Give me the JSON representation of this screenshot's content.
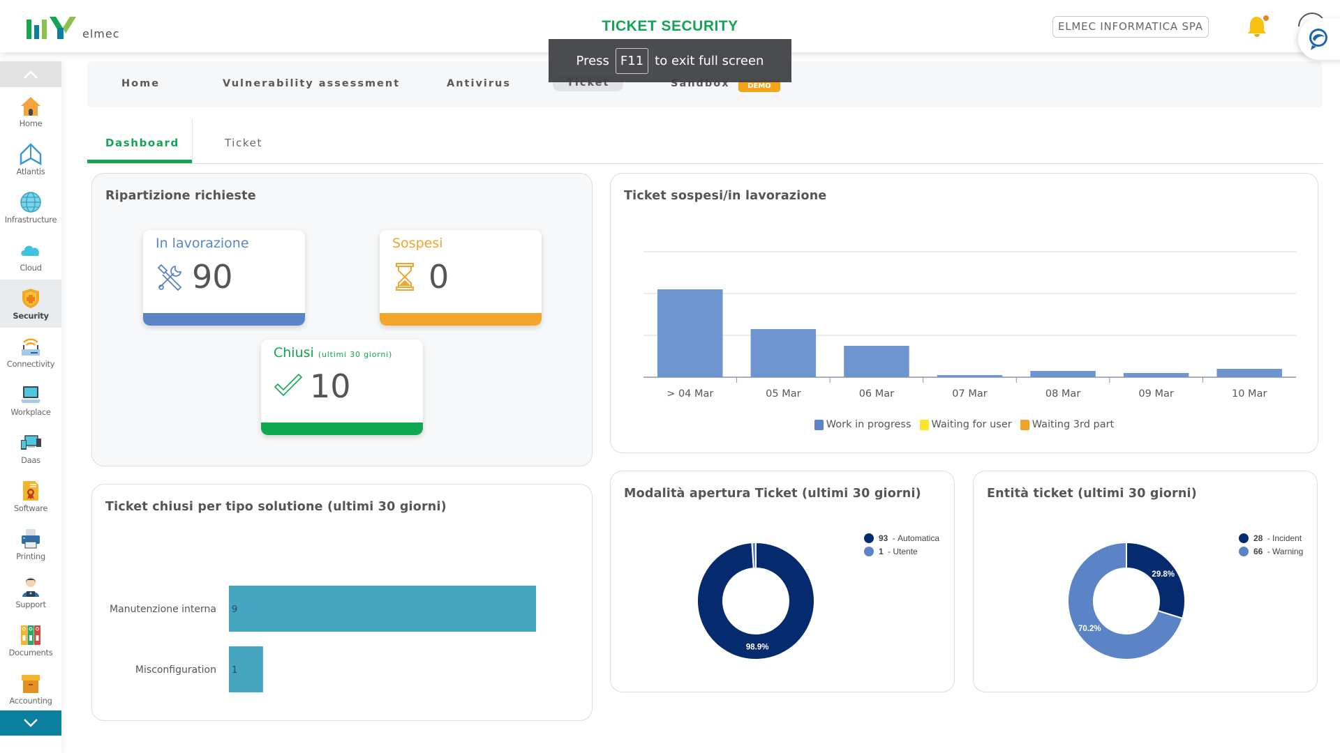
{
  "header": {
    "logo_text": "elmec",
    "title": "TICKET SECURITY",
    "company": "ELMEC INFORMATICA SPA",
    "notification_icon": "bell-icon",
    "chat_icon": "chat-support-icon"
  },
  "fullscreen_notice": {
    "prefix": "Press",
    "key": "F11",
    "suffix": "to exit full screen"
  },
  "sidebar": {
    "items": [
      {
        "label": "Home",
        "icon": "home-icon"
      },
      {
        "label": "Atlantis",
        "icon": "atlantis-icon"
      },
      {
        "label": "Infrastructure",
        "icon": "globe-icon"
      },
      {
        "label": "Cloud",
        "icon": "cloud-icon"
      },
      {
        "label": "Security",
        "icon": "shield-icon",
        "active": true
      },
      {
        "label": "Connectivity",
        "icon": "router-icon"
      },
      {
        "label": "Workplace",
        "icon": "laptop-icon"
      },
      {
        "label": "Daas",
        "icon": "devices-icon"
      },
      {
        "label": "Software",
        "icon": "certificate-icon"
      },
      {
        "label": "Printing",
        "icon": "printer-icon"
      },
      {
        "label": "Support",
        "icon": "operator-icon"
      },
      {
        "label": "Documents",
        "icon": "binders-icon"
      },
      {
        "label": "Accounting",
        "icon": "box-icon"
      }
    ]
  },
  "topnav": {
    "items": [
      {
        "label": "Home"
      },
      {
        "label": "Vulnerability assessment"
      },
      {
        "label": "Antivirus"
      },
      {
        "label": "Ticket",
        "active": true
      },
      {
        "label": "Sandbox",
        "badge": "DEMO"
      }
    ]
  },
  "subtabs": [
    {
      "label": "Dashboard",
      "active": true
    },
    {
      "label": "Ticket"
    }
  ],
  "ripartizione": {
    "title": "Ripartizione richieste",
    "cards": [
      {
        "label": "In lavorazione",
        "value": "90",
        "color": "#5a84c6",
        "icon": "tools-icon"
      },
      {
        "label": "Sospesi",
        "value": "0",
        "color": "#f3a42a",
        "icon": "hourglass-icon"
      },
      {
        "label": "Chiusi",
        "sublabel": "(ultimi 30 giorni)",
        "value": "10",
        "color": "#0fa84f",
        "icon": "checkmark-icon"
      }
    ]
  },
  "chart_data": [
    {
      "type": "bar",
      "title": "Ticket sospesi/in lavorazione",
      "categories": [
        "> 04 Mar",
        "05 Mar",
        "06 Mar",
        "07 Mar",
        "08 Mar",
        "09 Mar",
        "10 Mar"
      ],
      "series": [
        {
          "name": "Work in progress",
          "color": "#6e95cf",
          "values": [
            42,
            23,
            15,
            1,
            3,
            2,
            4
          ]
        },
        {
          "name": "Waiting for user",
          "color": "#fce52e",
          "values": [
            0,
            0,
            0,
            0,
            0,
            0,
            0
          ]
        },
        {
          "name": "Waiting 3rd part",
          "color": "#f0a32c",
          "values": [
            0,
            0,
            0,
            0,
            0,
            0,
            0
          ]
        }
      ],
      "ylim": [
        0,
        60
      ],
      "grid": true,
      "legend": "bottom",
      "xlabel": "",
      "ylabel": ""
    },
    {
      "type": "bar",
      "orientation": "horizontal",
      "title": "Ticket chiusi per tipo solutione (ultimi 30 giorni)",
      "categories": [
        "Manutenzione interna",
        "Misconfiguration"
      ],
      "values": [
        9,
        1
      ],
      "color": "#46a6c0",
      "xlim": [
        0,
        10
      ],
      "data_labels": true
    },
    {
      "type": "pie",
      "donut": true,
      "title": "Modalità apertura Ticket (ultimi 30 giorni)",
      "slices": [
        {
          "label": "Automatica",
          "value": 93,
          "percent_label": "98.9%",
          "color": "#062a6e"
        },
        {
          "label": "Utente",
          "value": 1,
          "percent_label": "",
          "color": "#5a84c6"
        }
      ],
      "legend": "top-right"
    },
    {
      "type": "pie",
      "donut": true,
      "title": "Entità ticket (ultimi 30 giorni)",
      "slices": [
        {
          "label": "Incident",
          "value": 28,
          "percent_label": "29.8%",
          "color": "#062a6e"
        },
        {
          "label": "Warning",
          "value": 66,
          "percent_label": "70.2%",
          "color": "#5a84c6"
        }
      ],
      "legend": "top-right"
    }
  ]
}
